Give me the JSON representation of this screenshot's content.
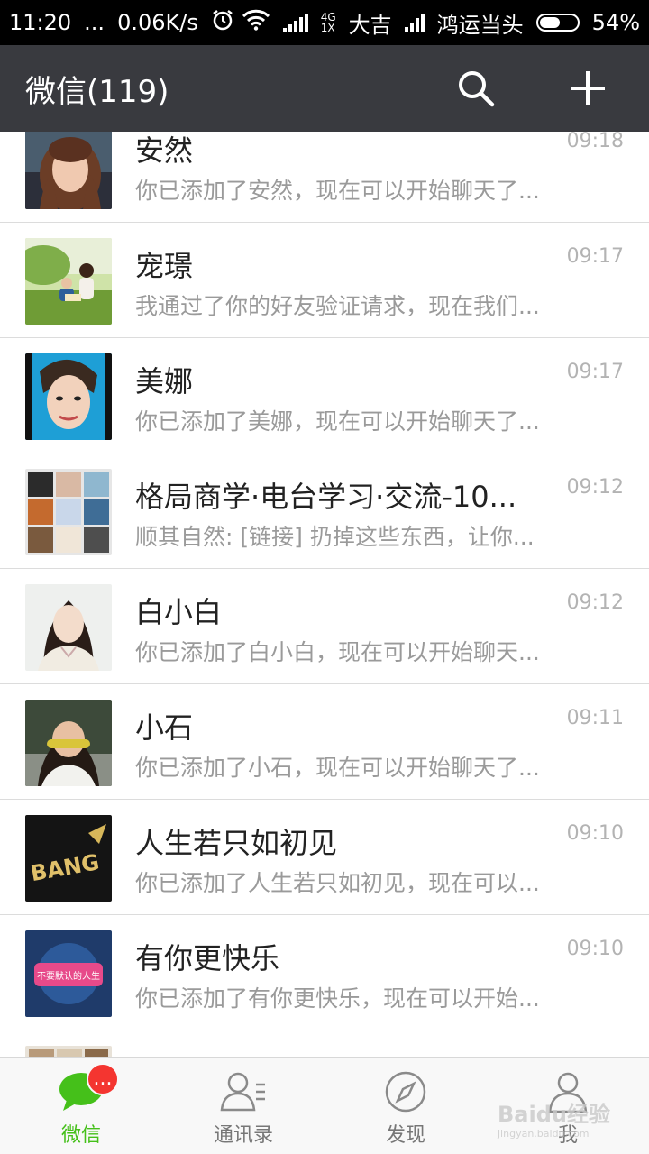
{
  "status_bar": {
    "time": "11:20",
    "dots": "...",
    "speed": "0.06K/s",
    "network_top": "4G",
    "network_bottom": "1X",
    "carrier1": "大吉",
    "carrier2": "鸿运当头",
    "battery_text": "54%",
    "battery_level": 0.54
  },
  "header": {
    "title": "微信(119)",
    "search_icon": "search-icon",
    "add_icon": "plus-icon"
  },
  "chats": [
    {
      "name": "安然",
      "message": "你已添加了安然，现在可以开始聊天了...",
      "time": "09:18",
      "avatar": "photo-woman-brown-hair"
    },
    {
      "name": "宠璟",
      "message": "我通过了你的好友验证请求，现在我们...",
      "time": "09:17",
      "avatar": "photo-mother-child-outdoors"
    },
    {
      "name": "美娜",
      "message": "你已添加了美娜，现在可以开始聊天了...",
      "time": "09:17",
      "avatar": "photo-woman-smiling"
    },
    {
      "name": "格局商学·电台学习·交流-10...",
      "message": "顺其自然: [链接] 扔掉这些东西，让你...",
      "time": "09:12",
      "avatar": "group-grid-avatar"
    },
    {
      "name": "白小白",
      "message": "你已添加了白小白，现在可以开始聊天...",
      "time": "09:12",
      "avatar": "photo-woman-white-top"
    },
    {
      "name": "小石",
      "message": "你已添加了小石，现在可以开始聊天了...",
      "time": "09:11",
      "avatar": "photo-woman-eating"
    },
    {
      "name": "人生若只如初见",
      "message": "你已添加了人生若只如初见，现在可以...",
      "time": "09:10",
      "avatar": "graffiti-bang"
    },
    {
      "name": "有你更快乐",
      "message": "你已添加了有你更快乐，现在可以开始...",
      "time": "09:10",
      "avatar": "logo-show-poster"
    }
  ],
  "avatar_texts": {
    "bang": "BANG",
    "poster": "不要默认的人生"
  },
  "bottom_nav": {
    "items": [
      {
        "label": "微信",
        "icon": "chat-bubble-icon",
        "active": true,
        "badge": "..."
      },
      {
        "label": "通讯录",
        "icon": "contacts-icon",
        "active": false
      },
      {
        "label": "发现",
        "icon": "compass-icon",
        "active": false
      },
      {
        "label": "我",
        "icon": "person-icon",
        "active": false
      }
    ]
  },
  "watermark": {
    "text": "Baidu经验",
    "sub": "jingyan.baidu.com"
  },
  "colors": {
    "header_bg": "#393a3f",
    "accent_green": "#45c01a",
    "badge_red": "#f43530"
  }
}
